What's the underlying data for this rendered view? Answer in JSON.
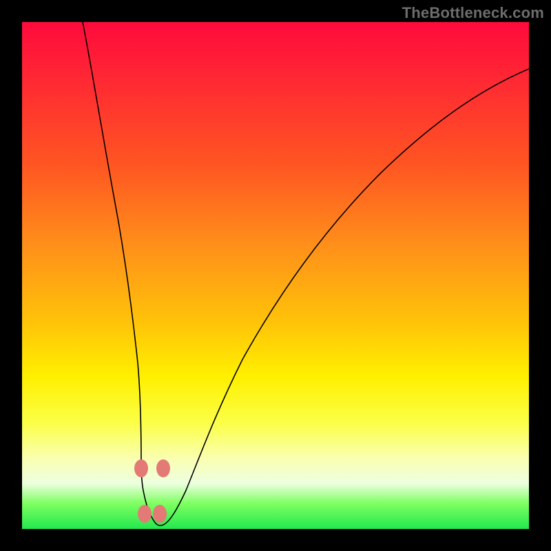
{
  "watermark": {
    "text": "TheBottleneck.com"
  },
  "chart_data": {
    "type": "line",
    "title": "",
    "xlabel": "",
    "ylabel": "",
    "xlim": [
      0,
      100
    ],
    "ylim": [
      0,
      100
    ],
    "grid": false,
    "legend": false,
    "series": [
      {
        "name": "bottleneck-curve",
        "x": [
          12,
          14,
          16,
          18,
          20,
          22,
          23.5,
          25,
          26.5,
          27.5,
          30,
          35,
          40,
          48,
          58,
          70,
          84,
          100
        ],
        "y": [
          100,
          88,
          75,
          60,
          44,
          27,
          14,
          4,
          1,
          1,
          4,
          15,
          28,
          46,
          62,
          75,
          84,
          89
        ]
      }
    ],
    "markers": [
      {
        "x": 23.5,
        "y": 12
      },
      {
        "x": 27.5,
        "y": 12
      },
      {
        "x": 24.0,
        "y": 3
      },
      {
        "x": 27.0,
        "y": 3
      }
    ],
    "background_gradient": [
      {
        "pos": 0,
        "color": "#ff0a3c"
      },
      {
        "pos": 0.7,
        "color": "#fff000"
      },
      {
        "pos": 0.9,
        "color": "#faffb0"
      },
      {
        "pos": 1.0,
        "color": "#23e84e"
      }
    ]
  }
}
